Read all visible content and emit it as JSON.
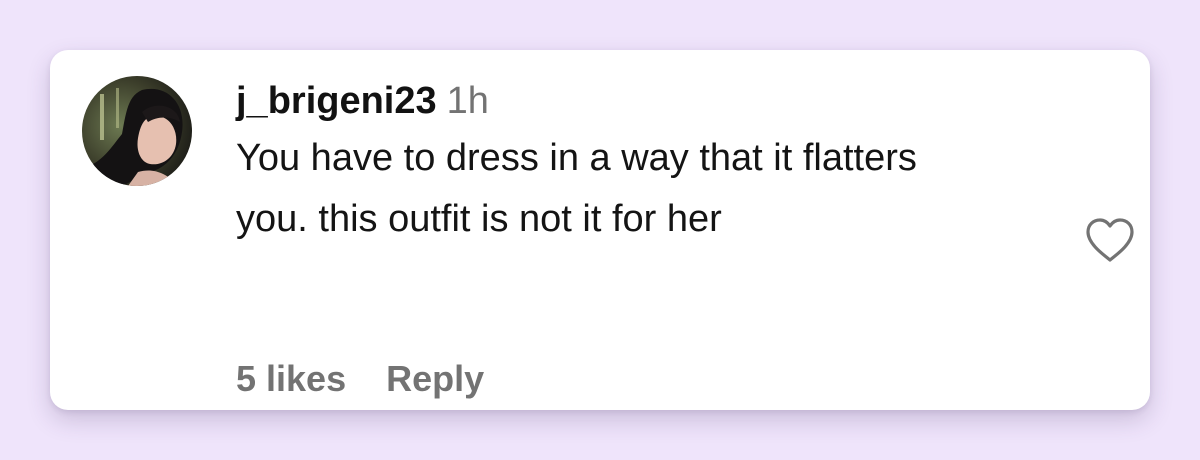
{
  "comment": {
    "username": "j_brigeni23",
    "time": "1h",
    "text": "You have to dress in a way that it flatters you. this outfit is not it for her",
    "likes": "5 likes",
    "reply_label": "Reply"
  },
  "icons": {
    "like": "heart-outline-icon",
    "avatar": "user-avatar-photo"
  },
  "colors": {
    "background": "#efe4fb",
    "card": "#ffffff",
    "username": "#121212",
    "secondary_text": "#737373"
  }
}
